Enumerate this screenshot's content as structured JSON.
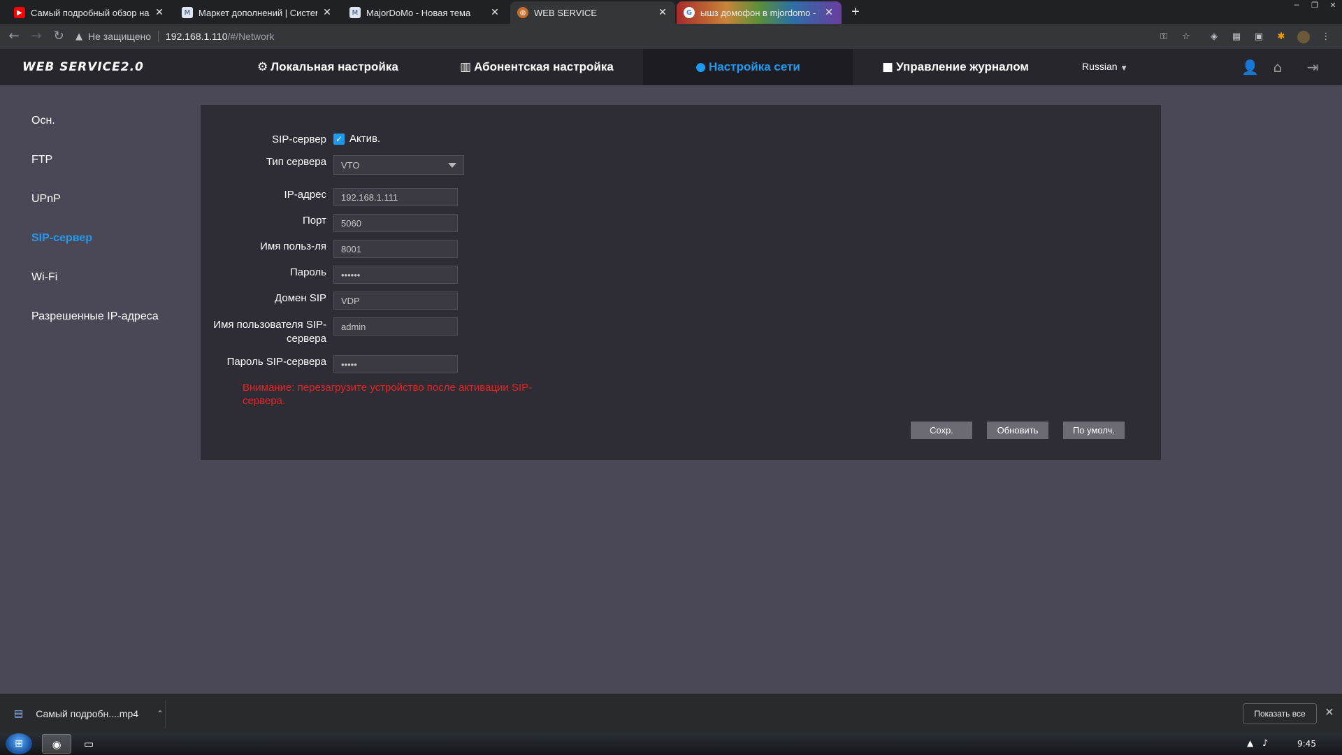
{
  "browser": {
    "tabs": [
      {
        "title": "Самый подробный обзор настр",
        "favicon": "youtube-icon"
      },
      {
        "title": "Маркет дополнений | Система",
        "favicon": "majordomo-icon"
      },
      {
        "title": "MajorDoMo - Новая тема",
        "favicon": "majordomo-icon"
      },
      {
        "title": "WEB SERVICE",
        "favicon": "globe-icon",
        "active": true
      },
      {
        "title": "ышз домофон в mjordomo - По",
        "favicon": "google-icon"
      }
    ],
    "security_label": "Не защищено",
    "url_host": "192.168.1.110",
    "url_path": "/#/Network"
  },
  "app": {
    "logo": "WEB SERVICE2.0",
    "nav": [
      {
        "label": "Локальная настройка",
        "icon": "gear-icon"
      },
      {
        "label": "Абонентская настройка",
        "icon": "building-icon"
      },
      {
        "label": "Настройка сети",
        "icon": "globe-icon",
        "active": true
      },
      {
        "label": "Управление журналом",
        "icon": "log-icon"
      }
    ],
    "language": "Russian"
  },
  "sidebar": {
    "items": [
      {
        "label": "Осн."
      },
      {
        "label": "FTP"
      },
      {
        "label": "UPnP"
      },
      {
        "label": "SIP-сервер",
        "active": true
      },
      {
        "label": "Wi-Fi"
      },
      {
        "label": "Разрешенные IP-адреса"
      }
    ]
  },
  "form": {
    "sip_server_label": "SIP-сервер",
    "sip_enabled_label": "Актив.",
    "sip_enabled": true,
    "server_type_label": "Тип сервера",
    "server_type_value": "VTO",
    "ip_label": "IP-адрес",
    "ip_value": "192.168.1.111",
    "port_label": "Порт",
    "port_value": "5060",
    "username_label": "Имя польз-ля",
    "username_value": "8001",
    "password_label": "Пароль",
    "password_value": "••••••",
    "sip_domain_label": "Домен SIP",
    "sip_domain_value": "VDP",
    "sip_user_label_1": "Имя пользователя SIP-",
    "sip_user_label_2": "сервера",
    "sip_user_value": "admin",
    "sip_password_label": "Пароль SIP-сервера",
    "sip_password_value": "•••••",
    "warning": "Внимание: перезагрузите устройство после активации SIP-сервера.",
    "save_label": "Сохр.",
    "refresh_label": "Обновить",
    "default_label": "По умолч."
  },
  "downloads": {
    "file_name": "Самый подробн....mp4",
    "show_all_label": "Показать все"
  },
  "taskbar": {
    "clock": "9:45"
  },
  "colors": {
    "accent": "#1e9bf0",
    "warning": "#e52424",
    "panel": "#2e2d35",
    "page": "#4a4856"
  }
}
